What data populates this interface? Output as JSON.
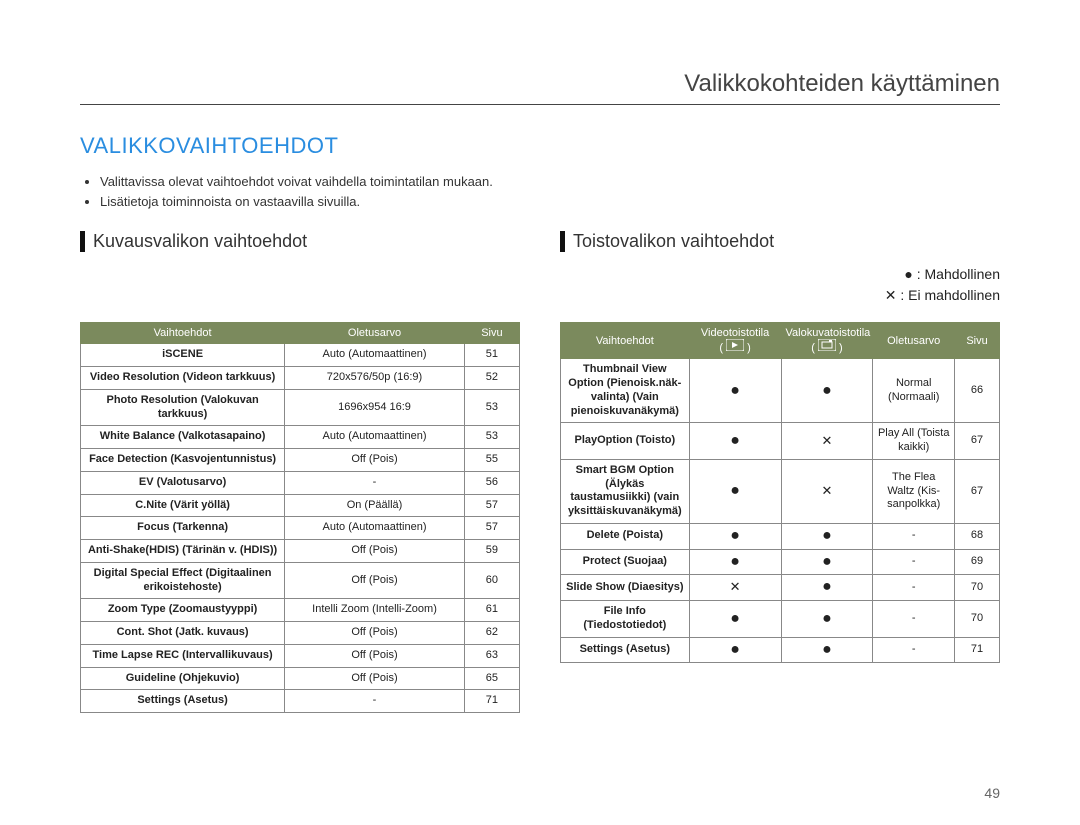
{
  "chapterTitle": "Valikkokohteiden käyttäminen",
  "sectionTitle": "VALIKKOVAIHTOEHDOT",
  "intro": [
    "Valittavissa olevat vaihtoehdot voivat vaihdella toimintatilan mukaan.",
    "Lisätietoja toiminnoista on vastaavilla sivuilla."
  ],
  "leftColumn": {
    "header": "Kuvausvalikon vaihtoehdot",
    "th": {
      "option": "Vaihtoehdot",
      "default": "Oletusarvo",
      "page": "Sivu"
    },
    "rows": [
      {
        "option": "iSCENE",
        "default": "Auto (Automaattinen)",
        "page": "51"
      },
      {
        "option": "Video Resolution (Videon tarkkuus)",
        "default": "720x576/50p (16:9)",
        "page": "52"
      },
      {
        "option": "Photo Resolution (Valokuvan tarkkuus)",
        "default": "1696x954 16:9",
        "page": "53"
      },
      {
        "option": "White Balance (Valkotasapaino)",
        "default": "Auto (Automaattinen)",
        "page": "53"
      },
      {
        "option": "Face Detection (Kasvojentunnistus)",
        "default": "Off (Pois)",
        "page": "55"
      },
      {
        "option": "EV (Valotusarvo)",
        "default": "-",
        "page": "56"
      },
      {
        "option": "C.Nite (Värit yöllä)",
        "default": "On (Päällä)",
        "page": "57"
      },
      {
        "option": "Focus (Tarkenna)",
        "default": "Auto (Automaattinen)",
        "page": "57"
      },
      {
        "option": "Anti-Shake(HDIS) (Tärinän v. (HDIS))",
        "default": "Off (Pois)",
        "page": "59"
      },
      {
        "option": "Digital Special Effect (Digitaalinen erikoistehoste)",
        "default": "Off (Pois)",
        "page": "60"
      },
      {
        "option": "Zoom Type (Zoomaustyyppi)",
        "default": "Intelli Zoom (Intelli-Zoom)",
        "page": "61"
      },
      {
        "option": "Cont. Shot (Jatk. kuvaus)",
        "default": "Off (Pois)",
        "page": "62"
      },
      {
        "option": "Time Lapse REC (Intervallikuvaus)",
        "default": "Off (Pois)",
        "page": "63"
      },
      {
        "option": "Guideline (Ohjekuvio)",
        "default": "Off (Pois)",
        "page": "65"
      },
      {
        "option": "Settings (Asetus)",
        "default": "-",
        "page": "71"
      }
    ]
  },
  "rightColumn": {
    "header": "Toistovalikon vaihtoehdot",
    "legend": {
      "possible": "● : Mahdollinen",
      "impossible": "✕ : Ei mahdollinen"
    },
    "th": {
      "option": "Vaihtoehdot",
      "video": "Videotoistotila",
      "photo": "Valokuvatoistotila",
      "default": "Oletusarvo",
      "page": "Sivu"
    },
    "rows": [
      {
        "option": "Thumbnail View Option (Pienoisk.näk-valinta) (Vain pienoiskuvanäkymä)",
        "video": "●",
        "photo": "●",
        "default": "Normal (Normaali)",
        "page": "66"
      },
      {
        "option": "PlayOption (Toisto)",
        "video": "●",
        "photo": "✕",
        "default": "Play All (Toista kaikki)",
        "page": "67"
      },
      {
        "option": "Smart BGM Option (Älykäs taustamusiikki) (vain yksittäiskuvanäkymä)",
        "video": "●",
        "photo": "✕",
        "default": "The Flea Waltz (Kis-sanpolkka)",
        "page": "67"
      },
      {
        "option": "Delete (Poista)",
        "video": "●",
        "photo": "●",
        "default": "-",
        "page": "68"
      },
      {
        "option": "Protect (Suojaa)",
        "video": "●",
        "photo": "●",
        "default": "-",
        "page": "69"
      },
      {
        "option": "Slide Show (Diaesitys)",
        "video": "✕",
        "photo": "●",
        "default": "-",
        "page": "70"
      },
      {
        "option": "File Info (Tiedostotiedot)",
        "video": "●",
        "photo": "●",
        "default": "-",
        "page": "70"
      },
      {
        "option": "Settings (Asetus)",
        "video": "●",
        "photo": "●",
        "default": "-",
        "page": "71"
      }
    ]
  },
  "pageNumber": "49"
}
